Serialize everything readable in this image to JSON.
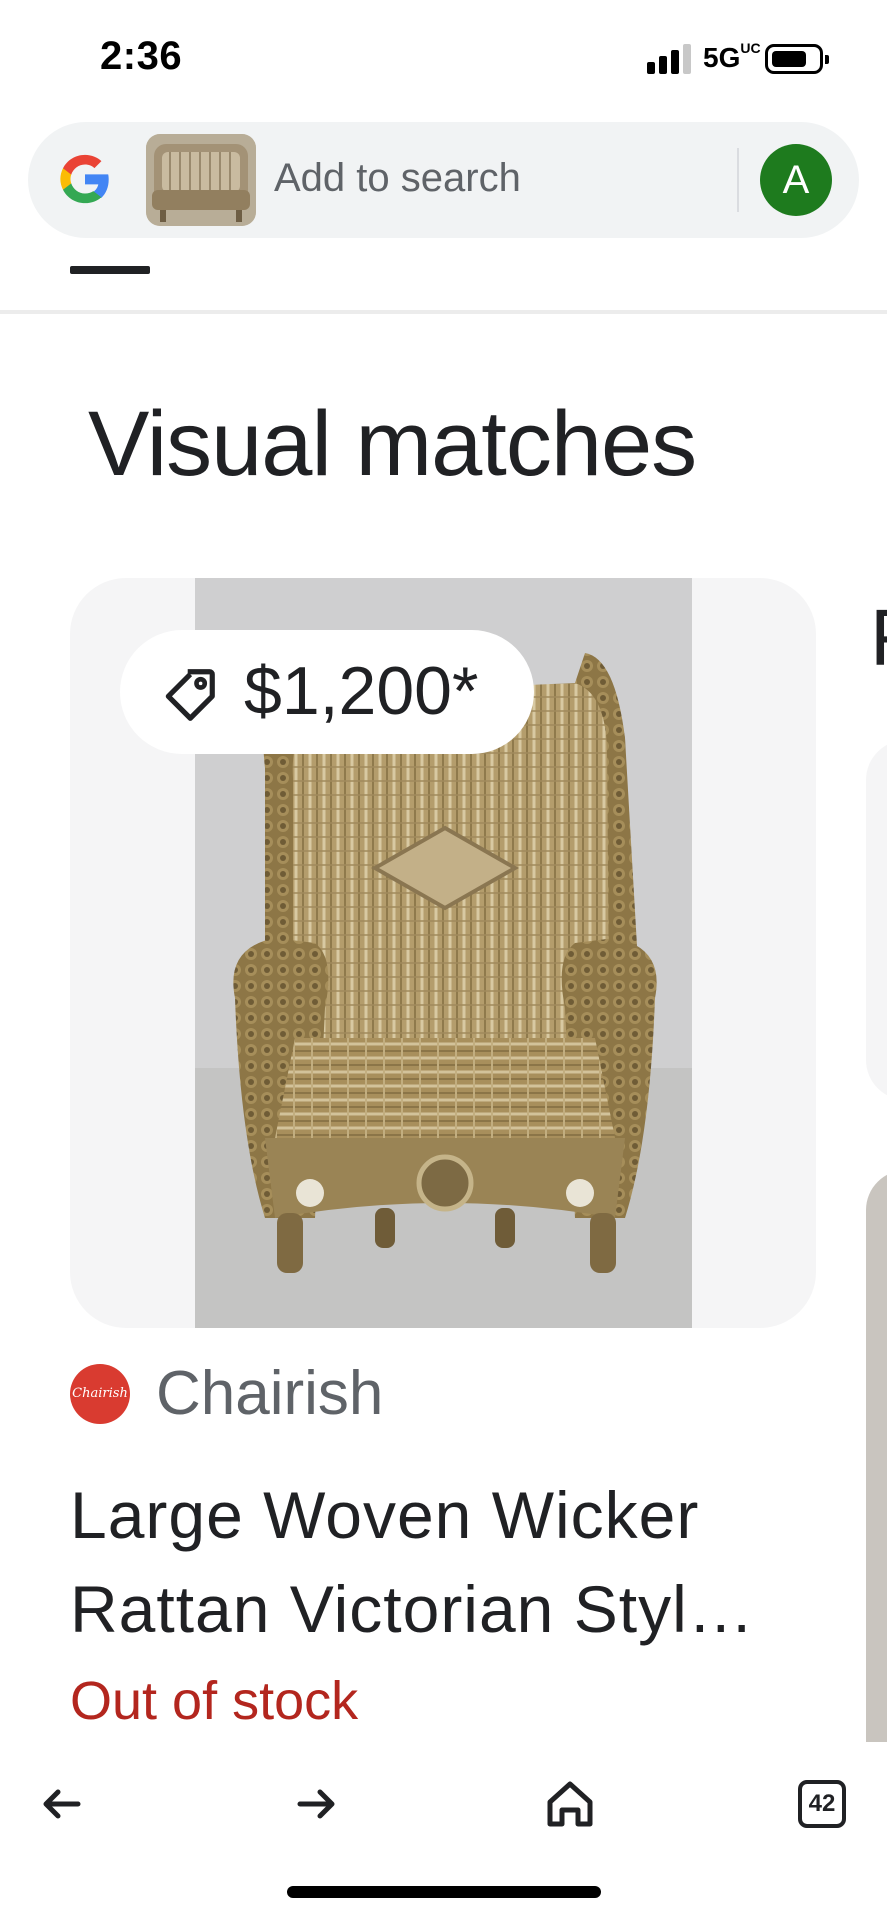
{
  "status_bar": {
    "time": "2:36",
    "network": "5G",
    "network_suffix": "UC",
    "signal_bars_active": 3,
    "signal_bars_total": 4,
    "battery_level": 0.7
  },
  "search": {
    "placeholder": "Add to search",
    "logo_icon": "google-g-icon",
    "avatar_initial": "A",
    "avatar_color": "#1e7b1e"
  },
  "section": {
    "title": "Visual matches"
  },
  "card": {
    "price": "$1,200*",
    "source_logo_text": "Chairish",
    "source_name": "Chairish",
    "title": "Large Woven Wicker Rattan Victorian Styl…",
    "stock": "Out of stock",
    "stock_color": "#b3261e"
  },
  "next_card": {
    "peek_letter": "F"
  },
  "toolbar": {
    "back_icon": "arrow-left-icon",
    "forward_icon": "arrow-right-icon",
    "home_icon": "home-icon",
    "tabs_count": "42"
  }
}
